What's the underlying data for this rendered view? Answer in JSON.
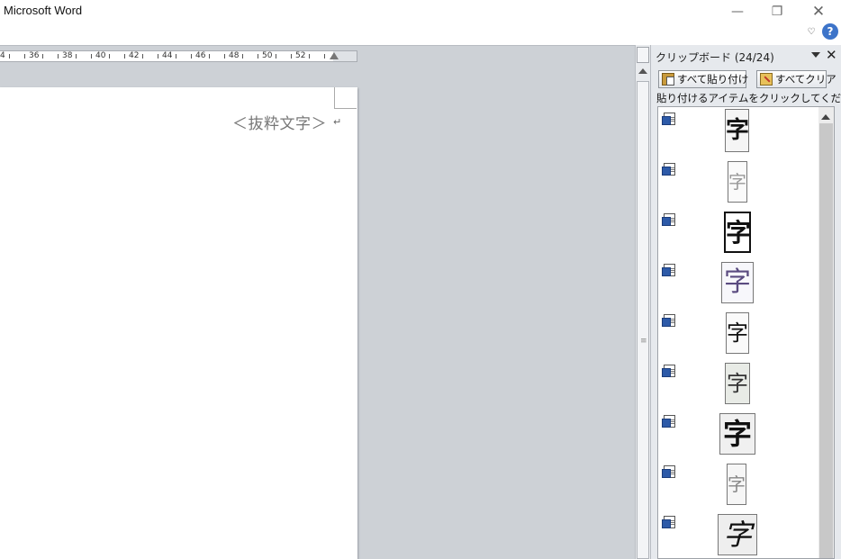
{
  "window": {
    "title": "Microsoft Word",
    "controls": {
      "minimize": "—",
      "restore": "❐",
      "close": "✕"
    },
    "ribbon_toggle": "♡",
    "help": "?"
  },
  "ruler": {
    "numbers": [
      "4",
      "36",
      "38",
      "40",
      "42",
      "44",
      "46",
      "48",
      "50",
      "52"
    ]
  },
  "document": {
    "text": "＜抜粋文字＞",
    "paragraph_mark": "↵"
  },
  "clipboard": {
    "title": "クリップボード (24/24)",
    "paste_all_label": "すべて貼り付け",
    "clear_all_label": "すべてクリア",
    "instruction": "貼り付けるアイテムをクリックしてください。",
    "items": [
      {
        "glyph": "字",
        "style": "bold"
      },
      {
        "glyph": "字",
        "style": "faint"
      },
      {
        "glyph": "字",
        "style": "boxed"
      },
      {
        "glyph": "字",
        "style": "purple"
      },
      {
        "glyph": "字",
        "style": "thin"
      },
      {
        "glyph": "字",
        "style": "gray"
      },
      {
        "glyph": "字",
        "style": "heavy"
      },
      {
        "glyph": "字",
        "style": "light"
      },
      {
        "glyph": "字",
        "style": "cursive"
      }
    ]
  }
}
